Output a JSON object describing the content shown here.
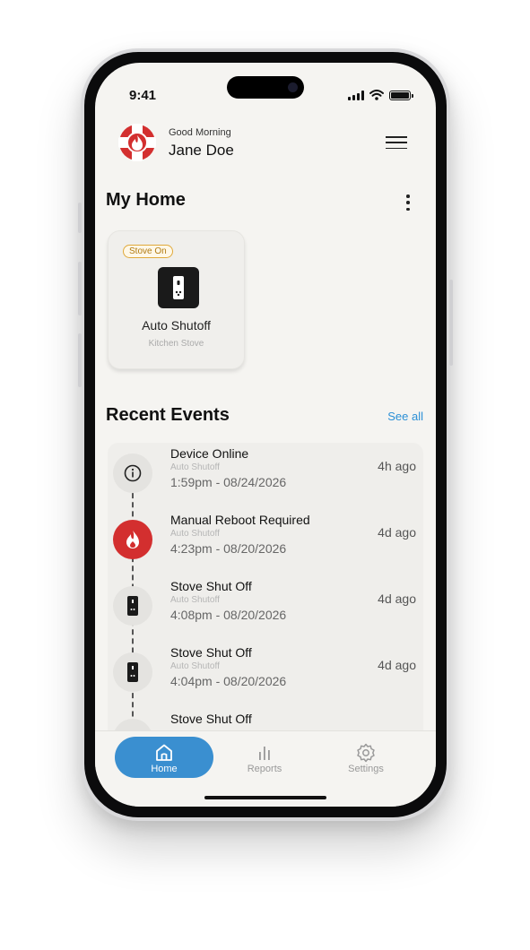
{
  "status": {
    "time": "9:41"
  },
  "header": {
    "greeting": "Good Morning",
    "user_name": "Jane Doe"
  },
  "home": {
    "title": "My Home",
    "devices": [
      {
        "status_badge": "Stove On",
        "name": "Auto Shutoff",
        "location": "Kitchen Stove",
        "icon": "stove-switch-icon"
      }
    ]
  },
  "events": {
    "title": "Recent Events",
    "see_all": "See all",
    "items": [
      {
        "title": "Device Online",
        "device": "Auto Shutoff",
        "time": "1:59pm - 08/24/2026",
        "ago": "4h ago",
        "icon": "info-icon",
        "tone": "grey"
      },
      {
        "title": "Manual Reboot Required",
        "device": "Auto Shutoff",
        "time": "4:23pm - 08/20/2026",
        "ago": "4d ago",
        "icon": "flame-icon",
        "tone": "red"
      },
      {
        "title": "Stove Shut Off",
        "device": "Auto Shutoff",
        "time": "4:08pm - 08/20/2026",
        "ago": "4d ago",
        "icon": "stove-switch-icon",
        "tone": "grey"
      },
      {
        "title": "Stove Shut Off",
        "device": "Auto Shutoff",
        "time": "4:04pm - 08/20/2026",
        "ago": "4d ago",
        "icon": "stove-switch-icon",
        "tone": "grey"
      },
      {
        "title": "Stove Shut Off",
        "device": "",
        "time": "",
        "ago": "",
        "icon": "stove-switch-icon",
        "tone": "grey"
      }
    ]
  },
  "tabs": [
    {
      "label": "Home",
      "icon": "home-icon",
      "active": true
    },
    {
      "label": "Reports",
      "icon": "bar-chart-icon",
      "active": false
    },
    {
      "label": "Settings",
      "icon": "gear-icon",
      "active": false
    }
  ],
  "colors": {
    "accent": "#3a8fd0",
    "alert": "#d32f2f",
    "badge": "#e0a93a",
    "link": "#2b8fd6"
  }
}
